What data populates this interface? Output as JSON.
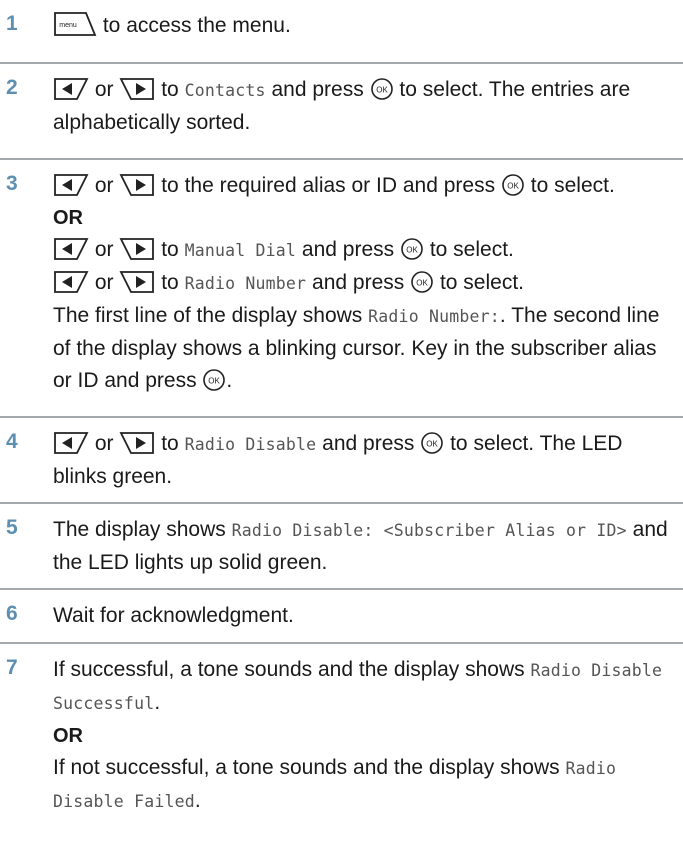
{
  "steps": [
    {
      "num": "1",
      "t1": "to access the menu."
    },
    {
      "num": "2",
      "or": "or",
      "t_to": "to",
      "mono1": "Contacts",
      "t_press": "and press",
      "t_sel": "to select. The entries are alphabetically sorted."
    },
    {
      "num": "3",
      "or": "or",
      "t_to": "to the required alias or ID and press",
      "t_sel": "to select.",
      "or_label": "OR",
      "l2_or": "or",
      "l2_to": "to",
      "l2_mono": "Manual Dial",
      "l2_press": "and press",
      "l2_sel": "to select.",
      "l3_or": "or",
      "l3_to": "to",
      "l3_mono": "Radio Number",
      "l3_press": "and press",
      "l3_sel": "to select.",
      "p1": "The first line of the display shows",
      "p1_mono": "Radio Number:",
      "p1_b": ". The second line of the display shows a blinking cursor. Key in the subscriber alias or ID and press",
      "p1_end": "."
    },
    {
      "num": "4",
      "or": "or",
      "t_to": "to",
      "mono1": "Radio Disable",
      "t_press": "and press",
      "t_sel": "to select. The LED blinks green."
    },
    {
      "num": "5",
      "t1": "The display shows",
      "mono1": "Radio Disable: <Subscriber Alias or ID>",
      "t2": "and the LED lights up solid green."
    },
    {
      "num": "6",
      "t1": "Wait for acknowledgment."
    },
    {
      "num": "7",
      "t1": "If successful, a tone sounds and the display shows",
      "mono1": "Radio Disable Successful",
      "t1_end": ".",
      "or_label": "OR",
      "t2": "If not successful, a tone sounds and the display shows",
      "mono2": "Radio Disable Failed",
      "t2_end": "."
    }
  ],
  "icons": {
    "menu_key": "menu-key-icon",
    "left_key": "left-arrow-key-icon",
    "right_key": "right-arrow-key-icon",
    "ok_key": "ok-key-icon",
    "menu_text": "menu",
    "ok_text": "OK"
  },
  "colors": {
    "step_number": "#5d8fb2",
    "divider": "#a3a9ad",
    "mono_text": "#555555"
  }
}
